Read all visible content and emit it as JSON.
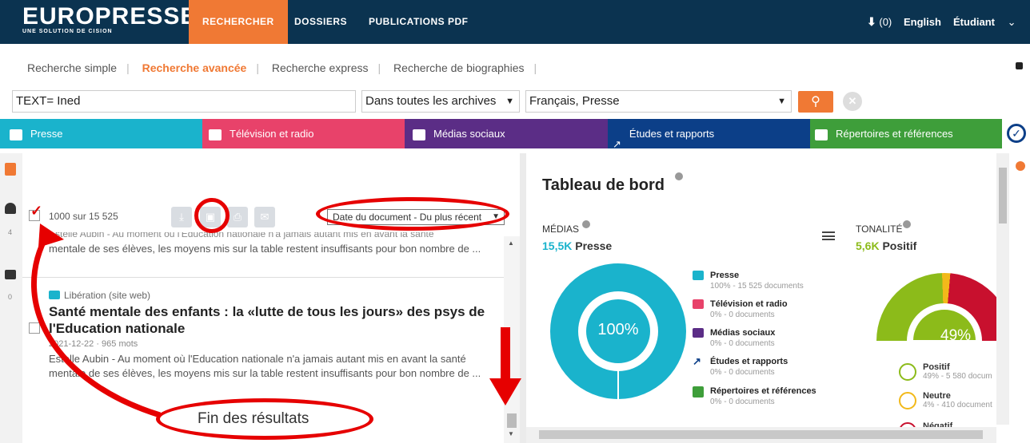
{
  "header": {
    "logo": "EUROPRESSE",
    "logo_sub": "UNE SOLUTION DE CISION",
    "nav": [
      "RECHERCHER",
      "DOSSIERS",
      "PUBLICATIONS PDF"
    ],
    "pin_count": "(0)",
    "language": "English",
    "user": "Étudiant"
  },
  "subnav": {
    "items": [
      "Recherche simple",
      "Recherche avancée",
      "Recherche express",
      "Recherche de biographies"
    ]
  },
  "search": {
    "query": "TEXT= Ined",
    "archive": "Dans toutes les archives",
    "language": "Français, Presse"
  },
  "categories": [
    "Presse",
    "Télévision et radio",
    "Médias sociaux",
    "Études et rapports",
    "Répertoires et références"
  ],
  "category_colors": [
    "#1ab3cc",
    "#e8426a",
    "#5b2d86",
    "#0c3f88",
    "#3e9e3a"
  ],
  "results": {
    "count": "1000 sur 15 525",
    "sort": "Date du document - Du plus récent",
    "snippet_top_1": "Estelle Aubin - Au moment où l'Education nationale n'a jamais autant mis en avant la santé",
    "snippet_top_2": "mentale de ses élèves, les moyens mis sur la table restent insuffisants pour bon nombre de ...",
    "source": "Libération (site web)",
    "title_1": "Santé mentale des enfants : la «lutte de tous les jours» des psys de",
    "title_2": "l'Education nationale",
    "meta": "2021-12-22 · 965 mots",
    "snippet_1": "Estelle Aubin - Au moment où l'Education nationale n'a jamais autant mis en avant la santé",
    "snippet_2": "mentale de ses élèves, les moyens mis sur la table restent insuffisants pour bon nombre de ...",
    "end_label": "Fin des résultats"
  },
  "rail": {
    "count_1": "4",
    "count_2": "0"
  },
  "dashboard": {
    "title": "Tableau de bord",
    "medias_label": "MÉDIAS",
    "medias_value": "15,5K",
    "medias_unit": "Presse",
    "donut_label": "100%",
    "legend": [
      {
        "name": "Presse",
        "sub": "100% - 15 525 documents",
        "color": "#1ab3cc"
      },
      {
        "name": "Télévision et radio",
        "sub": "0% - 0 documents",
        "color": "#e8426a"
      },
      {
        "name": "Médias sociaux",
        "sub": "0% - 0 documents",
        "color": "#5b2d86"
      },
      {
        "name": "Études et rapports",
        "sub": "0% - 0 documents",
        "color": "#0c3f88"
      },
      {
        "name": "Répertoires et références",
        "sub": "0% - 0 documents",
        "color": "#3e9e3a"
      }
    ],
    "tonal_label": "TONALITÉ",
    "tonal_value": "5,6K",
    "tonal_unit": "Positif",
    "gauge_label": "49%",
    "tone": [
      {
        "name": "Positif",
        "sub": "49% - 5 580 docum"
      },
      {
        "name": "Neutre",
        "sub": "4% - 410 document"
      },
      {
        "name": "Négatif"
      }
    ]
  }
}
